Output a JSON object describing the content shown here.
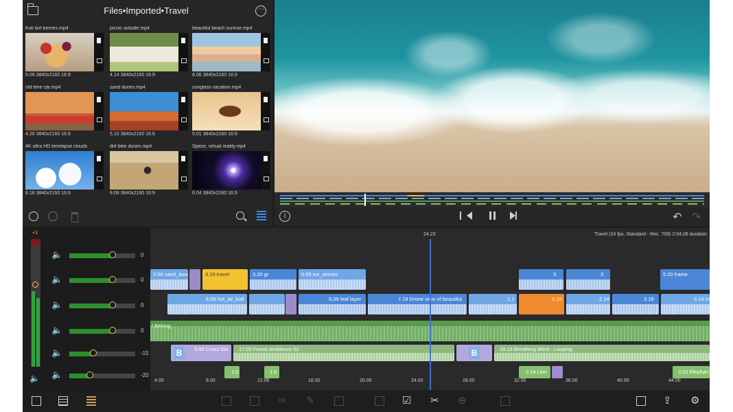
{
  "browser": {
    "breadcrumb": "Files•Imported•Travel",
    "clips": [
      {
        "title": "fruti tart berries.mp4",
        "meta": "5.09 3840x2160 16:9",
        "thumb": "tart"
      },
      {
        "title": "picnic outside.mp4",
        "meta": "4.14 3840x2160 16:9",
        "thumb": "picnic"
      },
      {
        "title": "beautiful beach sunrise.mp4",
        "meta": "8.06 3840x2160 16:9",
        "thumb": "beach"
      },
      {
        "title": "old time car.mp4",
        "meta": "4.20 3840x2160 16:9",
        "thumb": "car"
      },
      {
        "title": "sand dunes.mp4",
        "meta": "5.10 3840x2160 16:9",
        "thumb": "dunes"
      },
      {
        "title": "sunglass vacation.mp4",
        "meta": "5.01 3840x2160 16:9",
        "thumb": "sunglasses"
      },
      {
        "title": "4K ultra HD timelapse clouds",
        "meta": "8.18 3840x2160 16:9",
        "thumb": "clouds"
      },
      {
        "title": "dirt bike dunes.mp4",
        "meta": "8.06 3840x2160 16:9",
        "thumb": "bike"
      },
      {
        "title": "Space, virtual reality.mp4",
        "meta": "6.04 3840x2160 16:9",
        "thumb": "space"
      }
    ]
  },
  "mixer": {
    "master_top_label": "+1",
    "channels": [
      {
        "value": "0",
        "level": 0.65
      },
      {
        "value": "0",
        "level": 0.65
      },
      {
        "value": "0",
        "level": 0.65
      },
      {
        "value": "0",
        "level": 0.65
      },
      {
        "value": "-15",
        "level": 0.35
      },
      {
        "value": "-20",
        "level": 0.3
      }
    ]
  },
  "timeline": {
    "playhead_time": "24.23",
    "project_info": "Travel (24 fps, Standard - Rec. 709) 2:04.08 duration",
    "row1": [
      {
        "label": "3.06 sand_dune",
        "style": "video-light"
      },
      {
        "label": "3.15 travel",
        "style": "yellow"
      },
      {
        "label": "3.20 gr",
        "style": "video"
      },
      {
        "label": "5.09 ice_stream",
        "style": "video-light"
      },
      {
        "label": "3",
        "style": "video"
      },
      {
        "label": "3",
        "style": "video"
      },
      {
        "label": "5.20 frame",
        "style": "video"
      }
    ],
    "row2": [
      {
        "label": "6.00 hot_air_ball",
        "style": "video-light"
      },
      {
        "label": "5.09 leaf layer",
        "style": "video"
      },
      {
        "label": "7.19 Drone view of beautiful",
        "style": "video"
      },
      {
        "label": "2.1",
        "style": "video-light"
      },
      {
        "label": "2.16",
        "style": "orange"
      },
      {
        "label": "2.14",
        "style": "video-light"
      },
      {
        "label": "3.18",
        "style": "video"
      },
      {
        "label": "3.14 tree",
        "style": "video-light"
      }
    ],
    "music_label": "I Belong",
    "row4": [
      {
        "label": "5.00 Cross Dis",
        "type": "trans"
      },
      {
        "label": "17.05 Forest Ambience 02",
        "type": "amb"
      },
      {
        "label": "",
        "type": "trans"
      },
      {
        "label": "18.16 Breathing Wind - Looping",
        "type": "amb"
      }
    ],
    "row5": [
      {
        "label": "1.0"
      },
      {
        "label": "1.0"
      },
      {
        "label": "2.14 Lion"
      },
      {
        "label": "3.02 Elephan"
      }
    ],
    "ruler": [
      "4.00",
      "8.00",
      "12.00",
      "16.00",
      "20.00",
      "24.00",
      "28.00",
      "32.00",
      "36.00",
      "40.00",
      "44.00"
    ]
  },
  "icons": {
    "more": "⋯",
    "info": "i",
    "undo": "↶",
    "redo": "↷",
    "speaker": "🔈",
    "pencil": "✎",
    "scissors": "✂",
    "plus": "⊕",
    "check": "☑",
    "share": "⇪",
    "gear": "⚙"
  },
  "colors": {
    "video": "#4b87d6",
    "title": "#f2c230",
    "audio": "#5a9a4f",
    "playhead": "#3f6fd8",
    "selected": "#ef8a2e"
  }
}
